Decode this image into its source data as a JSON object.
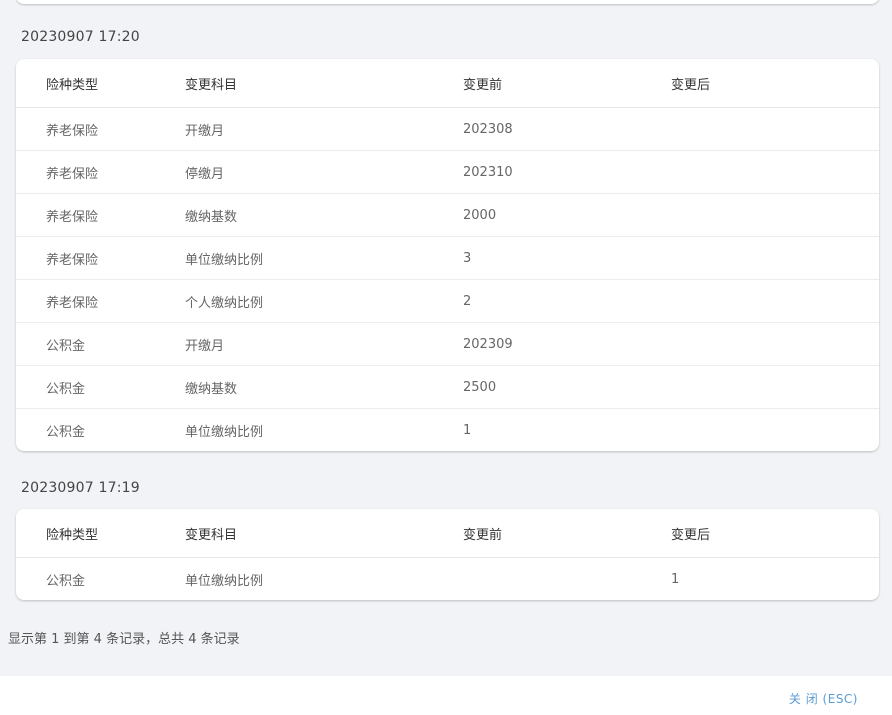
{
  "columns": [
    "险种类型",
    "变更科目",
    "变更前",
    "变更后"
  ],
  "groups": [
    {
      "timestamp": "20230907 17:20",
      "rows": [
        [
          "养老保险",
          "开缴月",
          "202308",
          ""
        ],
        [
          "养老保险",
          "停缴月",
          "202310",
          ""
        ],
        [
          "养老保险",
          "缴纳基数",
          "2000",
          ""
        ],
        [
          "养老保险",
          "单位缴纳比例",
          "3",
          ""
        ],
        [
          "养老保险",
          "个人缴纳比例",
          "2",
          ""
        ],
        [
          "公积金",
          "开缴月",
          "202309",
          ""
        ],
        [
          "公积金",
          "缴纳基数",
          "2500",
          ""
        ],
        [
          "公积金",
          "单位缴纳比例",
          "1",
          ""
        ]
      ]
    },
    {
      "timestamp": "20230907 17:19",
      "rows": [
        [
          "公积金",
          "单位缴纳比例",
          "",
          "1"
        ]
      ]
    }
  ],
  "pagination": {
    "info": "显示第 1 到第 4 条记录，总共 4 条记录"
  },
  "footer": {
    "close_label": "关 闭 (ESC)"
  },
  "colors": {
    "background": "#f1f3f6",
    "card": "#ffffff",
    "link": "#5b9bd5"
  }
}
